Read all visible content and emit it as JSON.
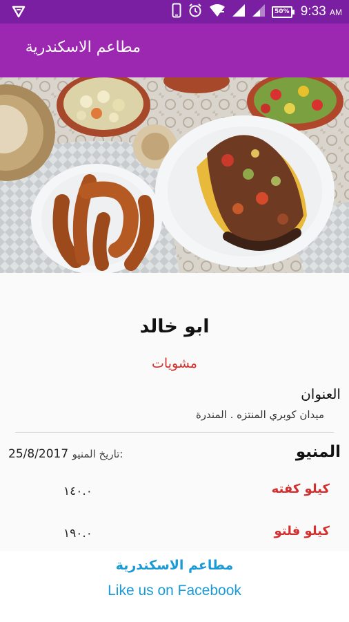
{
  "status_bar": {
    "time": "9:33",
    "ampm": "AM",
    "battery": "50%"
  },
  "app_bar": {
    "title": "مطاعم الاسكندرية"
  },
  "hero": {
    "image": "grilled-food-photo"
  },
  "restaurant": {
    "name": "ابو خالد",
    "category": "مشويات",
    "address_label": "العنوان",
    "address": "ميدان كوبري المنتزه . المندرة"
  },
  "menu": {
    "label": "المنيو",
    "date_label": "تاريخ المنيو:",
    "date": "25/8/2017",
    "items": [
      {
        "name": "كيلو كفته",
        "price": "١٤٠.٠"
      },
      {
        "name": "كيلو فلتو",
        "price": "١٩٠.٠"
      }
    ]
  },
  "footer": {
    "page_name": "مطاعم الاسكندرية",
    "link": "Like us on Facebook"
  },
  "colors": {
    "status_bar": "#7b1fa2",
    "app_bar": "#9c27b0",
    "accent_red": "#d32f2f",
    "link_blue": "#1a9ad6"
  }
}
